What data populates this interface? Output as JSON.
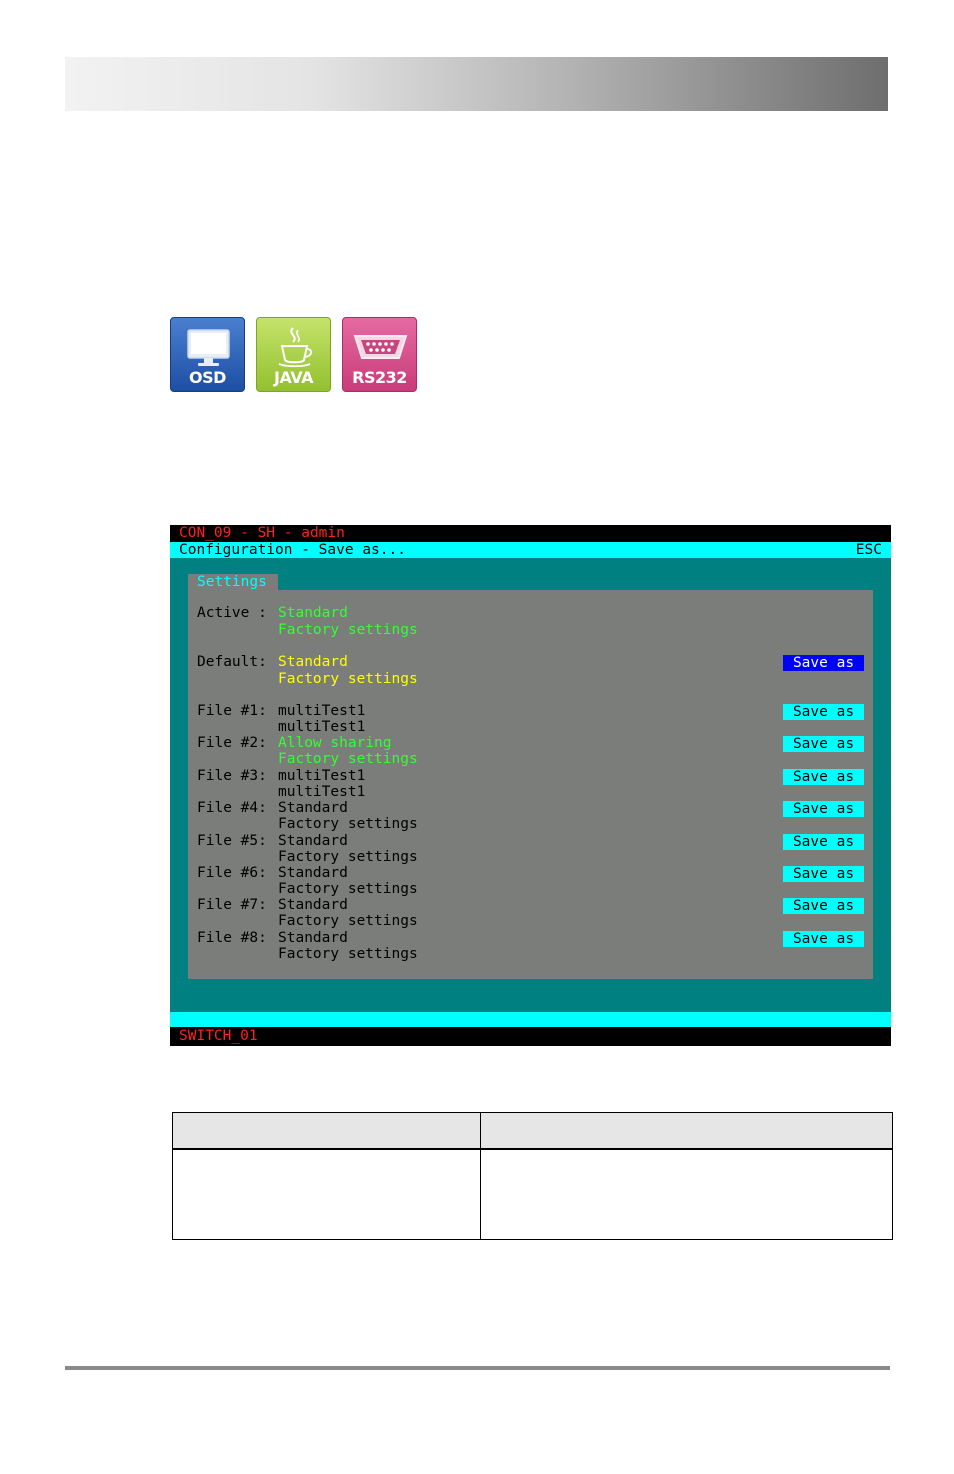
{
  "icons": [
    {
      "label": "OSD",
      "icon": "monitor-icon",
      "color": "#2458b0"
    },
    {
      "label": "JAVA",
      "icon": "java-cup-icon",
      "color": "#a6cc3f"
    },
    {
      "label": "RS232",
      "icon": "serial-port-icon",
      "color": "#d74a89"
    }
  ],
  "osd": {
    "top_bar": "CON_09 - SH - admin",
    "title": "Configuration - Save as...",
    "esc": "ESC",
    "tab": "Settings",
    "active_label": "Active :",
    "active_line1": "Standard",
    "active_line2": "Factory settings",
    "default_label": "Default:",
    "default_line1": "Standard",
    "default_line2": "Factory settings",
    "save_label": "Save as",
    "files": [
      {
        "label": "File #1:",
        "line1": "multiTest1",
        "line2": "multiTest1",
        "color": "black"
      },
      {
        "label": "File #2:",
        "line1": "Allow sharing",
        "line2": "Factory settings",
        "color": "green"
      },
      {
        "label": "File #3:",
        "line1": "multiTest1",
        "line2": "multiTest1",
        "color": "black"
      },
      {
        "label": "File #4:",
        "line1": "Standard",
        "line2": "Factory settings",
        "color": "black"
      },
      {
        "label": "File #5:",
        "line1": "Standard",
        "line2": "Factory settings",
        "color": "black"
      },
      {
        "label": "File #6:",
        "line1": "Standard",
        "line2": "Factory settings",
        "color": "black"
      },
      {
        "label": "File #7:",
        "line1": "Standard",
        "line2": "Factory settings",
        "color": "black"
      },
      {
        "label": "File #8:",
        "line1": "Standard",
        "line2": "Factory settings",
        "color": "black"
      }
    ],
    "status": "SWITCH_01"
  },
  "colors": {
    "osd_bg": "#008080",
    "osd_accent": "#00ffff",
    "panel": "#7a7d7a",
    "selected": "#0000ff"
  }
}
